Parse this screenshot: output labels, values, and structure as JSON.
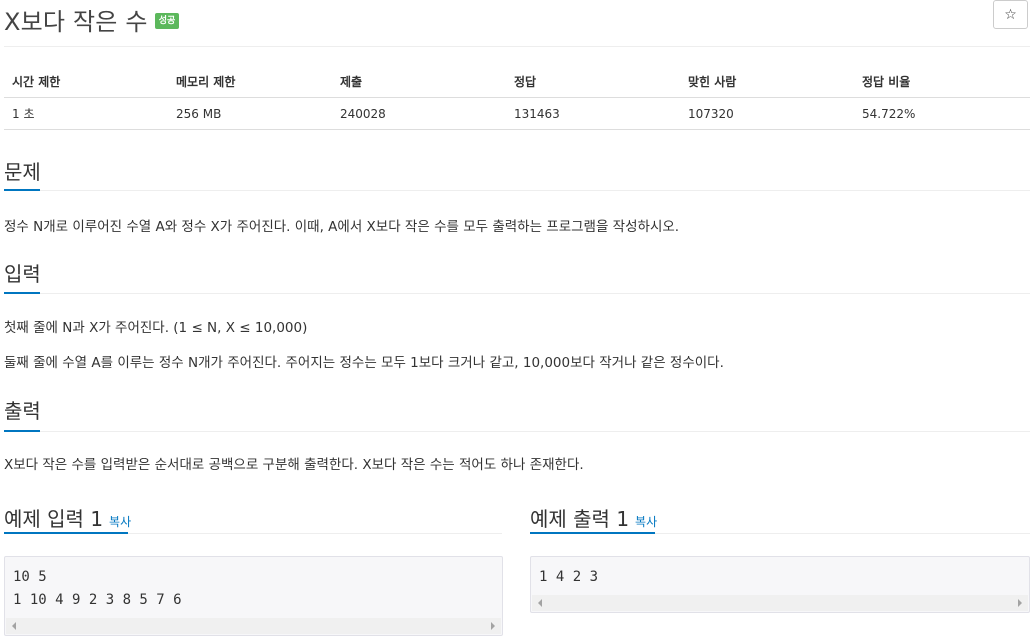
{
  "problem": {
    "title": "X보다 작은 수",
    "badge": "성공",
    "star_icon": "☆"
  },
  "info_table": {
    "headers": [
      "시간 제한",
      "메모리 제한",
      "제출",
      "정답",
      "맞힌 사람",
      "정답 비율"
    ],
    "values": [
      "1 초",
      "256 MB",
      "240028",
      "131463",
      "107320",
      "54.722%"
    ]
  },
  "sections": {
    "description": {
      "title": "문제",
      "text": "정수 N개로 이루어진 수열 A와 정수 X가 주어진다. 이때, A에서 X보다 작은 수를 모두 출력하는 프로그램을 작성하시오."
    },
    "input": {
      "title": "입력",
      "line1": "첫째 줄에 N과 X가 주어진다. (1 ≤ N, X ≤ 10,000)",
      "line2": "둘째 줄에 수열 A를 이루는 정수 N개가 주어진다. 주어지는 정수는 모두 1보다 크거나 같고, 10,000보다 작거나 같은 정수이다."
    },
    "output": {
      "title": "출력",
      "text": "X보다 작은 수를 입력받은 순서대로 공백으로 구분해 출력한다. X보다 작은 수는 적어도 하나 존재한다."
    }
  },
  "samples": {
    "input": {
      "title": "예제 입력 1",
      "copy_label": "복사",
      "content": "10 5\n1 10 4 9 2 3 8 5 7 6"
    },
    "output": {
      "title": "예제 출력 1",
      "copy_label": "복사",
      "content": "1 4 2 3"
    }
  },
  "colors": {
    "accent": "#0076c0",
    "badge_success": "#5cb85c"
  }
}
